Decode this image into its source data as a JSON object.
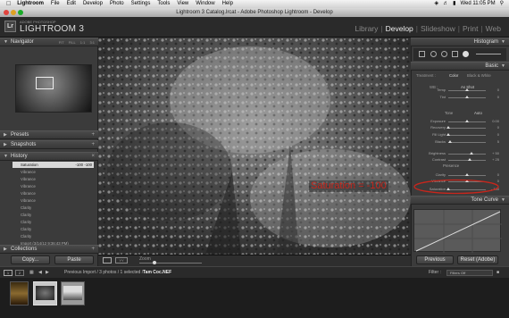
{
  "menubar": {
    "apple": "",
    "app": "Lightroom",
    "items": [
      "File",
      "Edit",
      "Develop",
      "Photo",
      "Settings",
      "Tools",
      "View",
      "Window",
      "Help"
    ],
    "clock": "Wed 11:05 PM"
  },
  "window": {
    "title": "Lightroom 3 Catalog.lrcat - Adobe Photoshop Lightroom - Develop"
  },
  "app": {
    "brand_small": "ADOBE PHOTOSHOP",
    "brand": "LIGHTROOM 3",
    "logo": "Lr"
  },
  "modules": [
    {
      "label": "Library"
    },
    {
      "label": "Develop"
    },
    {
      "label": "Slideshow"
    },
    {
      "label": "Print"
    },
    {
      "label": "Web"
    }
  ],
  "left_panel": {
    "navigator": {
      "title": "Navigator",
      "zoom_opts": [
        "FIT",
        "FILL",
        "1:1",
        "3:1"
      ]
    },
    "presets": "Presets",
    "snapshots": "Snapshots",
    "history": "History",
    "collections": "Collections",
    "history_rows": [
      {
        "label": "Saturation",
        "v1": "-100",
        "v2": "-100"
      },
      {
        "label": "Vibrance",
        "v1": "",
        "v2": ""
      },
      {
        "label": "Vibrance",
        "v1": "",
        "v2": ""
      },
      {
        "label": "Vibrance",
        "v1": "",
        "v2": ""
      },
      {
        "label": "Vibrance",
        "v1": "",
        "v2": ""
      },
      {
        "label": "Vibrance",
        "v1": "",
        "v2": ""
      },
      {
        "label": "Clarity",
        "v1": "",
        "v2": ""
      },
      {
        "label": "Clarity",
        "v1": "",
        "v2": ""
      },
      {
        "label": "Clarity",
        "v1": "",
        "v2": ""
      },
      {
        "label": "Clarity",
        "v1": "",
        "v2": ""
      },
      {
        "label": "Clarity",
        "v1": "",
        "v2": ""
      },
      {
        "label": "Import (3/14/12 9:36:43 PM)",
        "v1": "",
        "v2": ""
      }
    ],
    "copy": "Copy...",
    "paste": "Paste"
  },
  "annotation": "Saturation = -100",
  "toolbar": {
    "zoom_label": "Zoom"
  },
  "right_panel": {
    "histogram": "Histogram",
    "basic": "Basic",
    "treatment_label": "Treatment :",
    "color": "Color",
    "bw": "Black & White",
    "wb_label": "WB :",
    "wb_value": "As Shot",
    "tone": "Tone",
    "tone_auto": "Auto",
    "presence": "Presence",
    "sliders": [
      {
        "label": "Temp",
        "value": "0"
      },
      {
        "label": "Tint",
        "value": "0",
        "level": 0.5
      },
      {
        "label": "Exposure",
        "value": "0.00",
        "level": 0.5
      },
      {
        "label": "Recovery",
        "value": "0",
        "level": 0.0
      },
      {
        "label": "Fill Light",
        "value": "0",
        "level": 0.0
      },
      {
        "label": "Blacks",
        "value": "5",
        "level": 0.05
      },
      {
        "label": "Brightness",
        "value": "+ 50",
        "level": 0.62
      },
      {
        "label": "Contrast",
        "value": "+ 25",
        "level": 0.56
      },
      {
        "label": "Clarity",
        "value": "0",
        "level": 0.5
      },
      {
        "label": "Vibrance",
        "value": "0",
        "level": 0.5
      },
      {
        "label": "Saturation",
        "value": "- 100",
        "level": 0.0
      }
    ],
    "tone_curve": "Tone Curve",
    "previous": "Previous",
    "reset": "Reset (Adobe)"
  },
  "filmbar": {
    "pages": [
      "1",
      "2"
    ],
    "info": "Previous Import / 3 photos / 1 selected /",
    "file": "Tam Coc.NEF",
    "filter_label": "Filter :",
    "filter_value": "Filters Off"
  },
  "colors": {
    "annotation": "#c8261c",
    "accent": "#ffffff"
  }
}
